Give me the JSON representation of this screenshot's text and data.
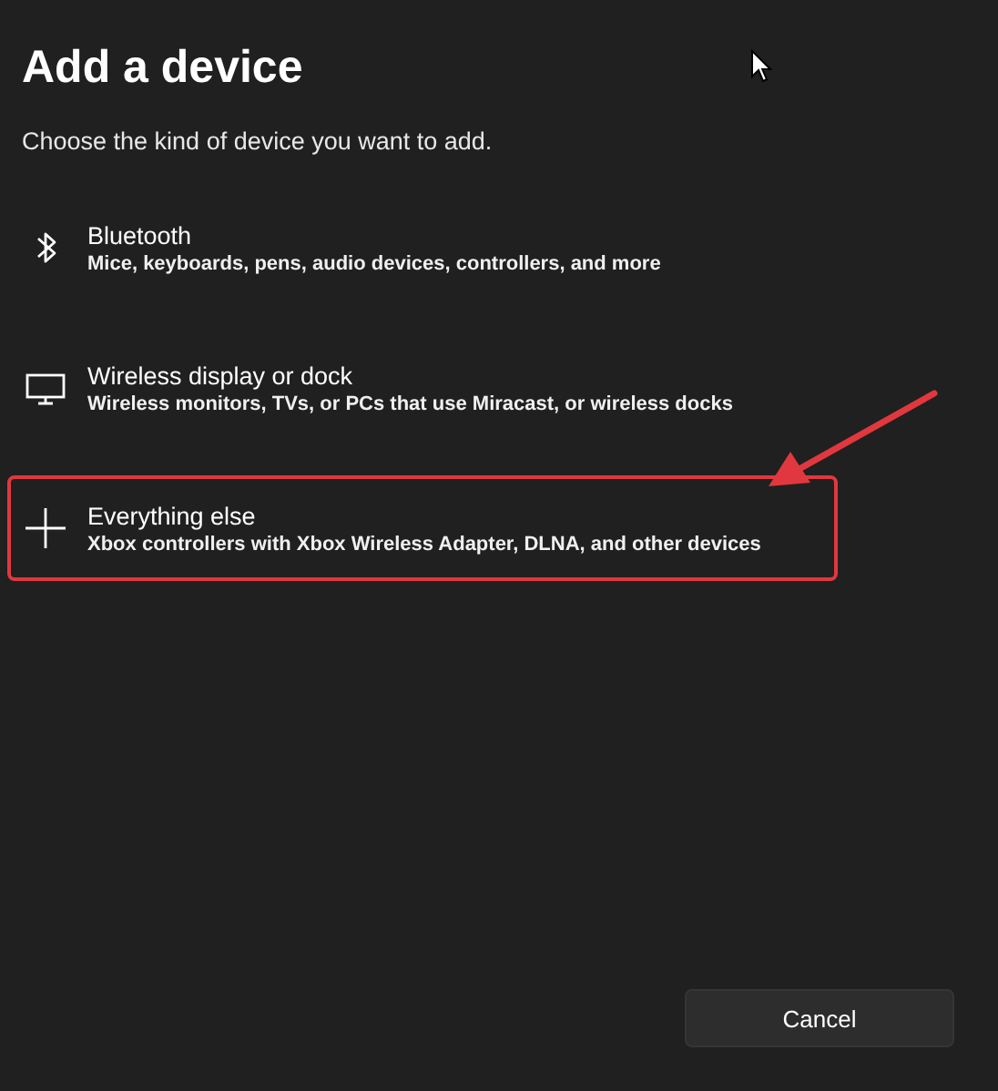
{
  "dialog": {
    "title": "Add a device",
    "subtitle": "Choose the kind of device you want to add."
  },
  "device_types": [
    {
      "kind": "bluetooth",
      "name": "Bluetooth",
      "description": "Mice, keyboards, pens, audio devices, controllers, and more",
      "highlighted": false
    },
    {
      "kind": "display",
      "name": "Wireless display or dock",
      "description": "Wireless monitors, TVs, or PCs that use Miracast, or wireless docks",
      "highlighted": false
    },
    {
      "kind": "other",
      "name": "Everything else",
      "description": "Xbox controllers with Xbox Wireless Adapter, DLNA, and other devices",
      "highlighted": true
    }
  ],
  "buttons": [
    "Cancel"
  ]
}
